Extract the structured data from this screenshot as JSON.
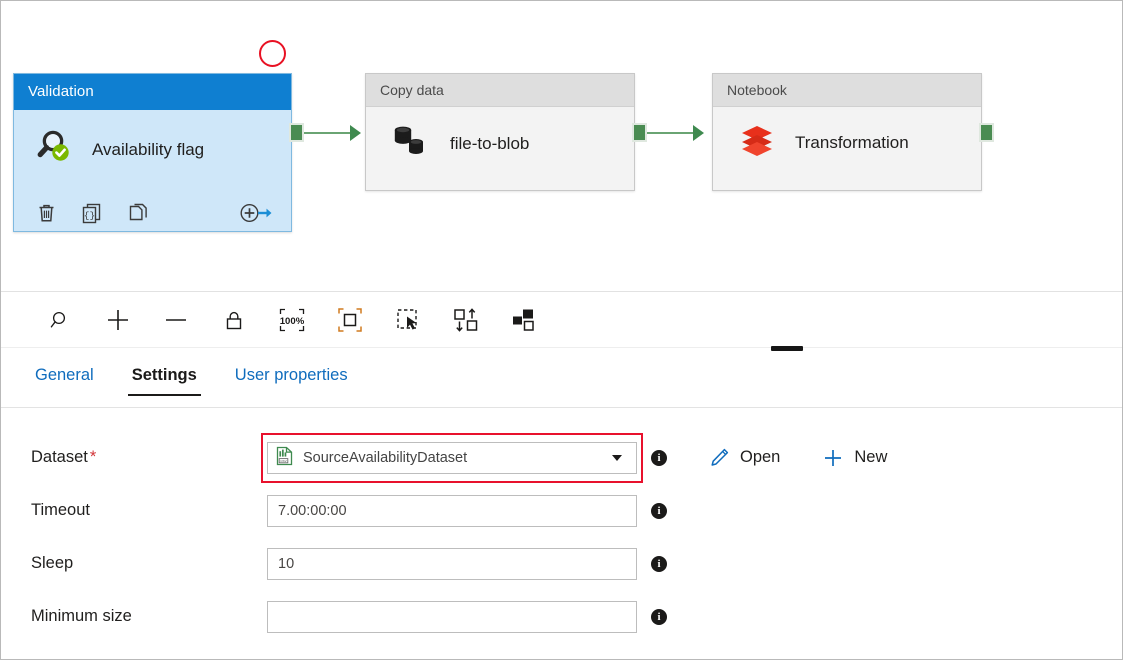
{
  "canvas": {
    "annotation": {
      "name": "red-circle-highlight"
    },
    "nodes": [
      {
        "type_label": "Validation",
        "name": "Availability flag",
        "icon": "magnifier-check-icon",
        "actions": [
          {
            "label": "Delete",
            "icon": "trash-icon"
          },
          {
            "label": "Code",
            "icon": "code-brackets-icon"
          },
          {
            "label": "Clone",
            "icon": "copy-icon"
          },
          {
            "label": "Add output",
            "icon": "add-output-arrow-icon"
          }
        ]
      },
      {
        "type_label": "Copy data",
        "name": "file-to-blob",
        "icon": "database-copy-icon"
      },
      {
        "type_label": "Notebook",
        "name": "Transformation",
        "icon": "databricks-stack-icon"
      }
    ]
  },
  "toolbar": {
    "buttons": [
      {
        "label": "Zoom",
        "icon": "magnifier-icon"
      },
      {
        "label": "Zoom in",
        "icon": "plus-icon"
      },
      {
        "label": "Zoom out",
        "icon": "minus-icon"
      },
      {
        "label": "Lock canvas",
        "icon": "lock-icon"
      },
      {
        "label": "Zoom to 100%",
        "icon": "zoom-100-percent-icon",
        "text": "100%"
      },
      {
        "label": "Zoom to fit",
        "icon": "zoom-to-fit-icon"
      },
      {
        "label": "Select",
        "icon": "marquee-select-icon"
      },
      {
        "label": "Auto align",
        "icon": "auto-align-icon"
      },
      {
        "label": "Arrange layout",
        "icon": "arrange-layout-icon"
      }
    ]
  },
  "tabs": [
    {
      "label": "General",
      "active": false
    },
    {
      "label": "Settings",
      "active": true
    },
    {
      "label": "User properties",
      "active": false
    }
  ],
  "form": {
    "fields": [
      {
        "label": "Dataset",
        "required": true,
        "required_mark": "*",
        "control": "combobox",
        "value": "SourceAvailabilityDataset",
        "placeholder": "",
        "icon": "csv-dataset-icon",
        "highlighted": true,
        "info": "i"
      },
      {
        "label": "Timeout",
        "required": false,
        "required_mark": "",
        "control": "text",
        "value": "7.00:00:00",
        "placeholder": "",
        "info": "i"
      },
      {
        "label": "Sleep",
        "required": false,
        "required_mark": "",
        "control": "text",
        "value": "10",
        "placeholder": "",
        "info": "i"
      },
      {
        "label": "Minimum size",
        "required": false,
        "required_mark": "",
        "control": "text",
        "value": "",
        "placeholder": "",
        "info": "i"
      }
    ],
    "commands": [
      {
        "label": "Open",
        "icon": "pencil-icon"
      },
      {
        "label": "New",
        "icon": "plus-icon"
      }
    ]
  },
  "colors": {
    "accent_blue": "#0f7fd1",
    "node_body_blue": "#cfe7f9",
    "link_blue": "#0f6cbd",
    "connector_green": "#4a8c52",
    "highlight_red": "#e8112d",
    "required_red": "#d13438",
    "databricks_red": "#e8301b",
    "check_green": "#7ab800"
  }
}
